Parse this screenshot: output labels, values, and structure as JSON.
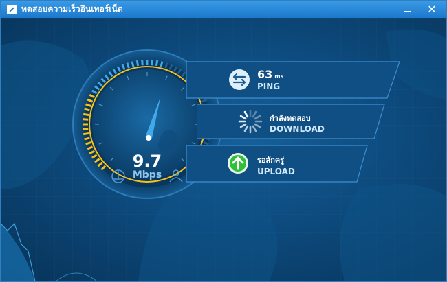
{
  "window": {
    "title": "ทดสอบความเร็วอินเทอร์เน็ต",
    "close_glyph": "✕"
  },
  "gauge": {
    "speed_value": "9.7",
    "speed_unit": "Mbps",
    "needle_fraction": 0.56,
    "accent_color": "#f5c21b"
  },
  "ping": {
    "value": "63",
    "unit": "ms",
    "label": "PING",
    "icon": "arrows-exchange-icon"
  },
  "download": {
    "status": "กำลังทดสอบ",
    "label": "DOWNLOAD",
    "icon": "loading-spinner-icon"
  },
  "upload": {
    "status": "รอสักครู่",
    "label": "UPLOAD",
    "icon": "up-arrow-icon",
    "icon_color": "#2fbf3a"
  }
}
